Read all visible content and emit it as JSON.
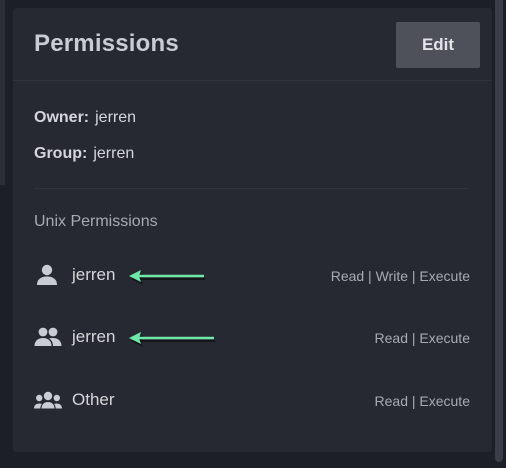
{
  "panel": {
    "title": "Permissions",
    "edit_label": "Edit"
  },
  "info": {
    "owner_key": "Owner:",
    "owner_value": "jerren",
    "group_key": "Group:",
    "group_value": "jerren"
  },
  "unix": {
    "section_title": "Unix Permissions",
    "rows": [
      {
        "icon": "user-icon",
        "name": "jerren",
        "rights": "Read | Write | Execute"
      },
      {
        "icon": "group-icon",
        "name": "jerren",
        "rights": "Read | Execute"
      },
      {
        "icon": "others-icon",
        "name": "Other",
        "rights": "Read | Execute"
      }
    ]
  },
  "colors": {
    "background": "#1d1f28",
    "card": "#262932",
    "button": "#4e5159",
    "arrow": "#6ee7a8"
  }
}
